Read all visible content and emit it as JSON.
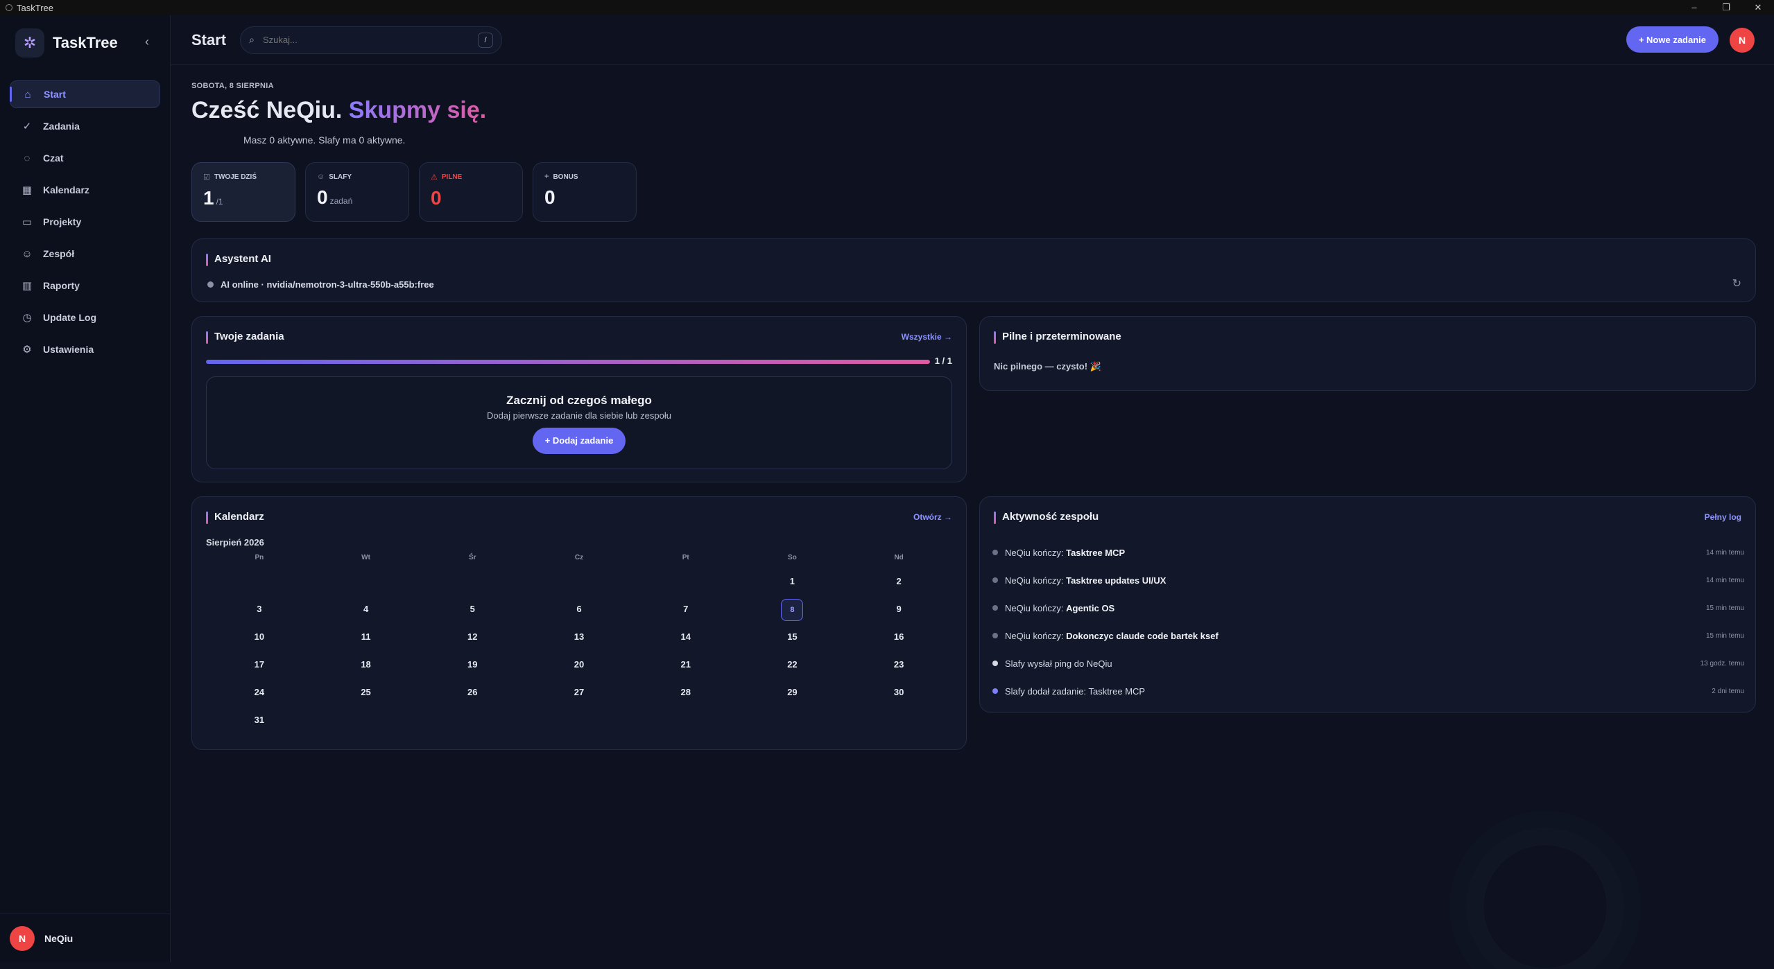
{
  "window": {
    "title": "TaskTree",
    "controls": [
      "–",
      "❐",
      "✕"
    ]
  },
  "sidebar": {
    "brand": "TaskTree",
    "items": [
      {
        "label": "Start",
        "icon": "home-icon",
        "glyph": "⌂",
        "active": true
      },
      {
        "label": "Zadania",
        "icon": "check-circle-icon",
        "glyph": "✓",
        "active": false
      },
      {
        "label": "Czat",
        "icon": "chat-icon",
        "glyph": "◌",
        "active": false
      },
      {
        "label": "Kalendarz",
        "icon": "calendar-icon",
        "glyph": "▦",
        "active": false
      },
      {
        "label": "Projekty",
        "icon": "folder-icon",
        "glyph": "▭",
        "active": false
      },
      {
        "label": "Zespół",
        "icon": "team-icon",
        "glyph": "☺",
        "active": false
      },
      {
        "label": "Raporty",
        "icon": "chart-icon",
        "glyph": "▥",
        "active": false
      },
      {
        "label": "Update Log",
        "icon": "clock-icon",
        "glyph": "◷",
        "active": false
      },
      {
        "label": "Ustawienia",
        "icon": "gear-icon",
        "glyph": "⚙",
        "active": false
      }
    ],
    "user": {
      "initial": "N",
      "name": "NeQiu"
    }
  },
  "topbar": {
    "title": "Start",
    "search_placeholder": "Szukaj...",
    "search_shortcut": "/",
    "new_task_label": "+ Nowe zadanie",
    "avatar_initial": "N"
  },
  "greeting": {
    "date": "SOBOTA, 8 SIERPNIA",
    "hello": "Cześć NeQiu.",
    "hello_accent": "Skupmy się.",
    "sub": "Masz 0 aktywne. Slafy ma 0 aktywne."
  },
  "stats": [
    {
      "label": "TWOJE DZIŚ",
      "value": "1",
      "suffix": "/1"
    },
    {
      "label": "SLAFY",
      "value": "0",
      "suffix": "zadań"
    },
    {
      "label": "PILNE",
      "value": "0",
      "suffix": ""
    },
    {
      "label": "BONUS",
      "value": "0",
      "suffix": ""
    }
  ],
  "ai": {
    "title": "Asystent AI",
    "status": "AI online · nvidia/nemotron-3-ultra-550b-a55b:free"
  },
  "tasks": {
    "title": "Twoje zadania",
    "link": "Wszystkie →",
    "progress": 1.0,
    "progress_text": "1 / 1",
    "empty_title": "Zacznij od czegoś małego",
    "empty_sub": "Dodaj pierwsze zadanie dla siebie lub zespołu",
    "add_label": "+ Dodaj zadanie"
  },
  "urgent": {
    "title": "Pilne i przeterminowane",
    "text": "Nic pilnego — czysto! 🎉"
  },
  "calendar": {
    "title": "Kalendarz",
    "link": "Otwórz →",
    "month": "Sierpień 2026",
    "weekdays": [
      "Pn",
      "Wt",
      "Śr",
      "Cz",
      "Pt",
      "So",
      "Nd"
    ],
    "weeks": [
      [
        "",
        "",
        "",
        "",
        "",
        "1",
        "2"
      ],
      [
        "3",
        "4",
        "5",
        "6",
        "7",
        "8",
        "9"
      ],
      [
        "10",
        "11",
        "12",
        "13",
        "14",
        "15",
        "16"
      ],
      [
        "17",
        "18",
        "19",
        "20",
        "21",
        "22",
        "23"
      ],
      [
        "24",
        "25",
        "26",
        "27",
        "28",
        "29",
        "30"
      ],
      [
        "31",
        "",
        "",
        "",
        "",
        "",
        ""
      ]
    ],
    "today": "8"
  },
  "activity": {
    "title": "Aktywność zespołu",
    "link": "Pełny log",
    "items": [
      {
        "prefix": "NeQiu kończy: ",
        "bold": "Tasktree  MCP",
        "time": "14 min temu",
        "color": "#6b7287"
      },
      {
        "prefix": "NeQiu kończy: ",
        "bold": "Tasktree updates UI/UX",
        "time": "14 min temu",
        "color": "#6b7287"
      },
      {
        "prefix": "NeQiu kończy: ",
        "bold": "Agentic OS",
        "time": "15 min temu",
        "color": "#6b7287"
      },
      {
        "prefix": "NeQiu kończy: ",
        "bold": "Dokonczyc claude code bartek ksef",
        "time": "15 min temu",
        "color": "#6b7287"
      },
      {
        "prefix": "Slafy wysłał ping do NeQiu",
        "bold": "",
        "time": "13 godz. temu",
        "color": "#d6d9e5"
      },
      {
        "prefix": "Slafy dodał zadanie: Tasktree  MCP",
        "bold": "",
        "time": "2 dni temu",
        "color": "#7c7ff7"
      }
    ]
  }
}
